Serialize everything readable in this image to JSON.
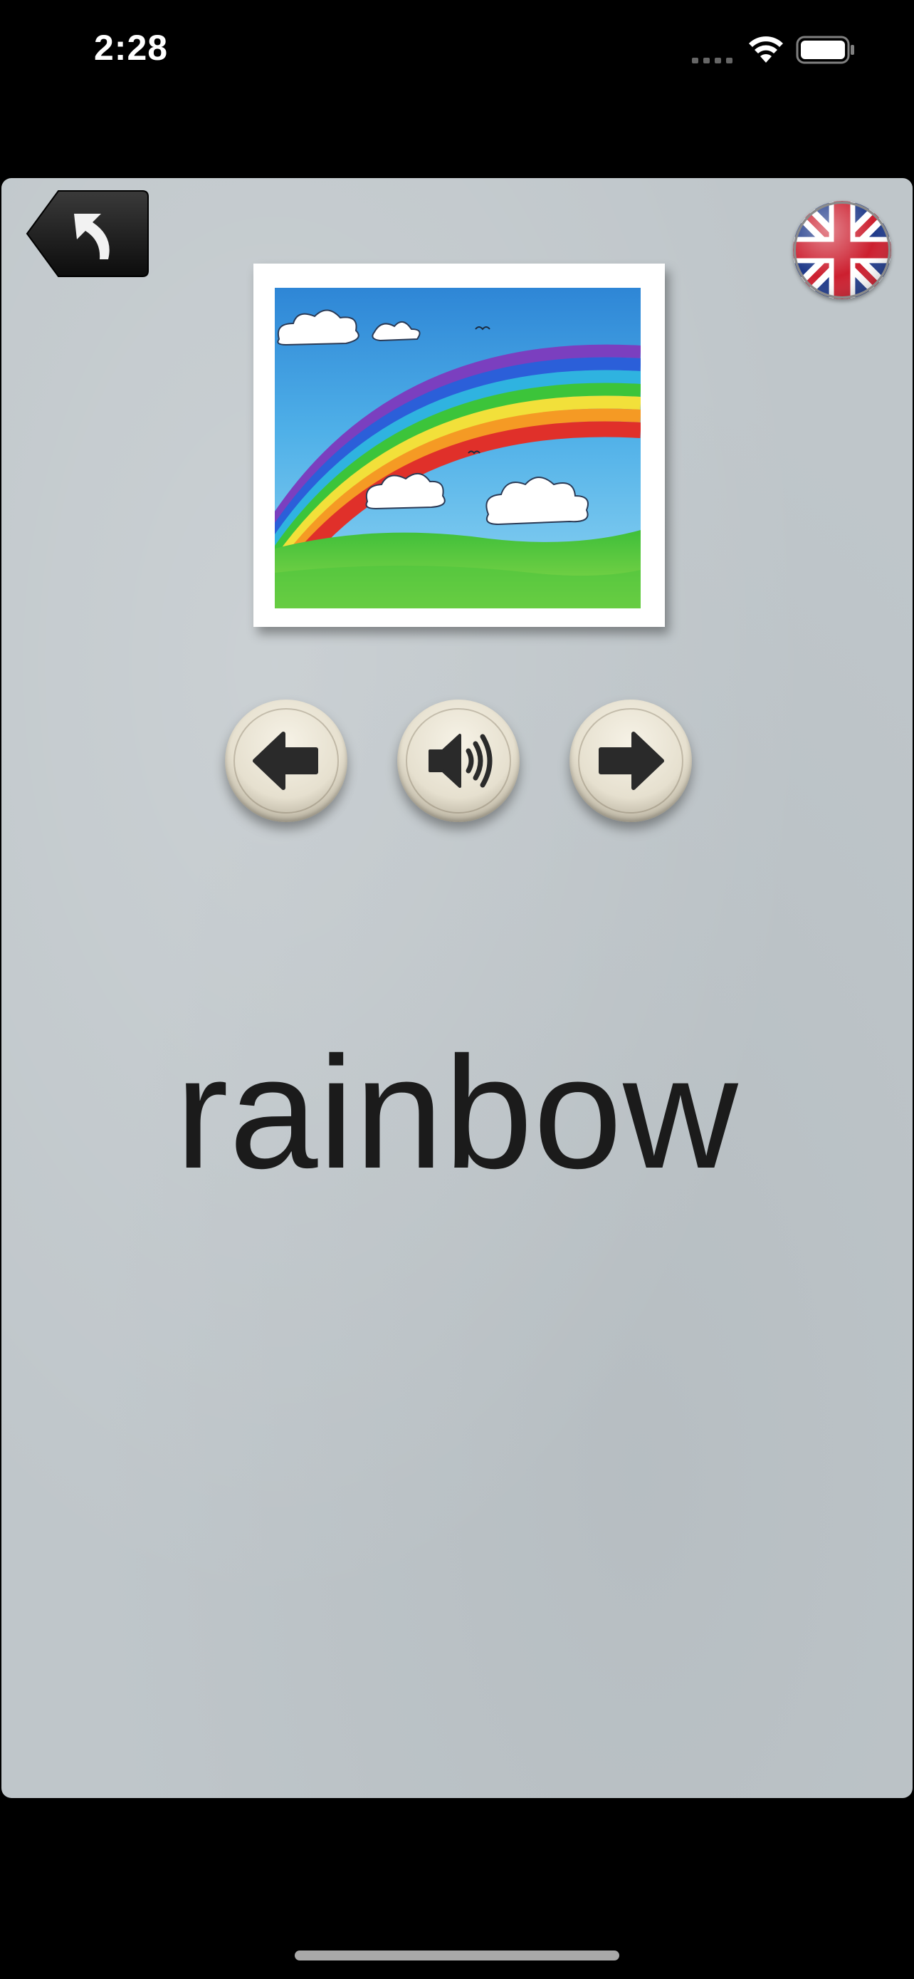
{
  "status_bar": {
    "time": "2:28",
    "icons": [
      "signal-icon",
      "wifi-icon",
      "battery-icon"
    ]
  },
  "flashcard": {
    "word": "rainbow",
    "image": "rainbow-illustration",
    "language": "uk-flag-icon"
  },
  "controls": {
    "back": "back-arrow-icon",
    "previous": "left-arrow-icon",
    "play_sound": "speaker-icon",
    "next": "right-arrow-icon"
  },
  "colors": {
    "panel_background": "#bfc6ca",
    "word_text": "#1b1b1b",
    "button_face": "#e6e0cf"
  }
}
